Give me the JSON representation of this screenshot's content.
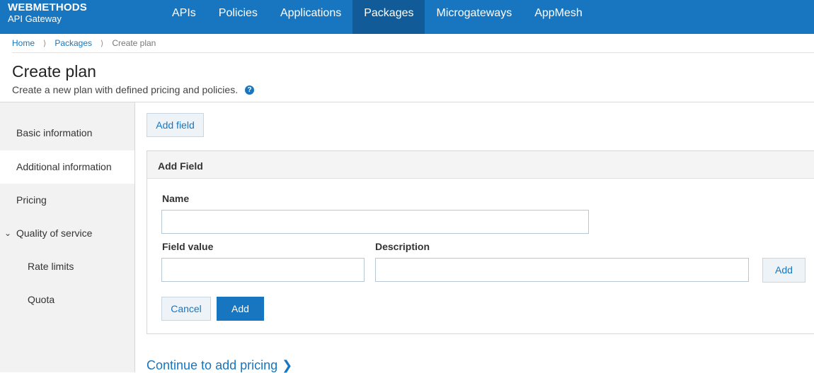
{
  "brand": {
    "name": "WEBMETHODS",
    "product": "API Gateway"
  },
  "nav": [
    {
      "label": "APIs",
      "active": false
    },
    {
      "label": "Policies",
      "active": false
    },
    {
      "label": "Applications",
      "active": false
    },
    {
      "label": "Packages",
      "active": true
    },
    {
      "label": "Microgateways",
      "active": false
    },
    {
      "label": "AppMesh",
      "active": false
    }
  ],
  "breadcrumb": {
    "home": "Home",
    "packages": "Packages",
    "current": "Create plan",
    "separator": "⟩"
  },
  "page": {
    "title": "Create plan",
    "description": "Create a new plan with defined pricing and policies."
  },
  "sidebar": {
    "items": [
      {
        "label": "Basic information"
      },
      {
        "label": "Additional information",
        "active": true
      },
      {
        "label": "Pricing"
      },
      {
        "label": "Quality of service",
        "expanded": true
      },
      {
        "label": "Rate limits"
      },
      {
        "label": "Quota"
      }
    ]
  },
  "main": {
    "add_field_button": "Add field",
    "panel": {
      "title": "Add Field",
      "name_label": "Name",
      "name_value": "",
      "field_value_label": "Field value",
      "field_value": "",
      "description_label": "Description",
      "description_value": "",
      "inline_add_button": "Add",
      "cancel_button": "Cancel",
      "add_button": "Add"
    },
    "continue_link": "Continue to add pricing"
  },
  "colors": {
    "accent": "#1776bf",
    "nav_active": "#115c98",
    "sidebar_bg": "#f2f2f2"
  },
  "icons": {
    "help": "question-circle-icon",
    "expand": "chevron-down-icon",
    "continue": "chevron-right-icon"
  }
}
